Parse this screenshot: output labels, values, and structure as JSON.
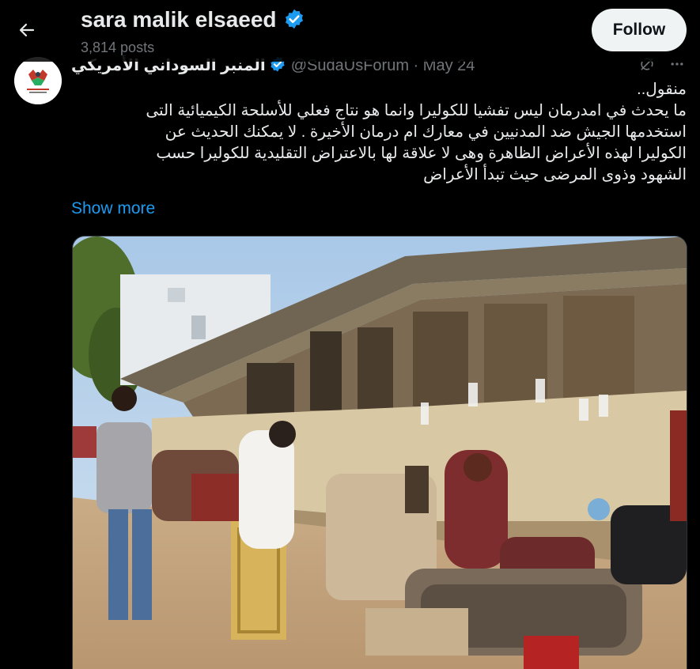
{
  "header": {
    "title": "sara malik elsaeed",
    "posts_count": "3,814 posts",
    "follow_label": "Follow",
    "back_icon": "arrow-left-icon",
    "verified_color": "#1d9bf0"
  },
  "tweet": {
    "author_name": "المنبر السوداني الأمريكي",
    "handle": "@SudaUsForum",
    "separator": "·",
    "date": "May 24",
    "body_lines": [
      "منقول..",
      "ما يحدث في امدرمان ليس تفشيا للكوليرا وانما هو نتاج فعلي للأسلحة الكيميائية التى",
      "استخدمها الجيش ضد المدنيين في معارك ام درمان الأخيرة . لا يمكنك الحديث عن",
      "الكوليرا لهذه الأعراض الظاهرة وهى لا علاقة لها بالاعتراض التقليدية للكوليرا حسب",
      "الشهود وذوى المرضى حيث تبدأ الأعراض"
    ],
    "show_more": "Show more",
    "tools": [
      "grok-icon",
      "more-icon"
    ]
  },
  "colors": {
    "background": "#000000",
    "text": "#e7e9ea",
    "muted": "#71767b",
    "link": "#1d9bf0"
  }
}
